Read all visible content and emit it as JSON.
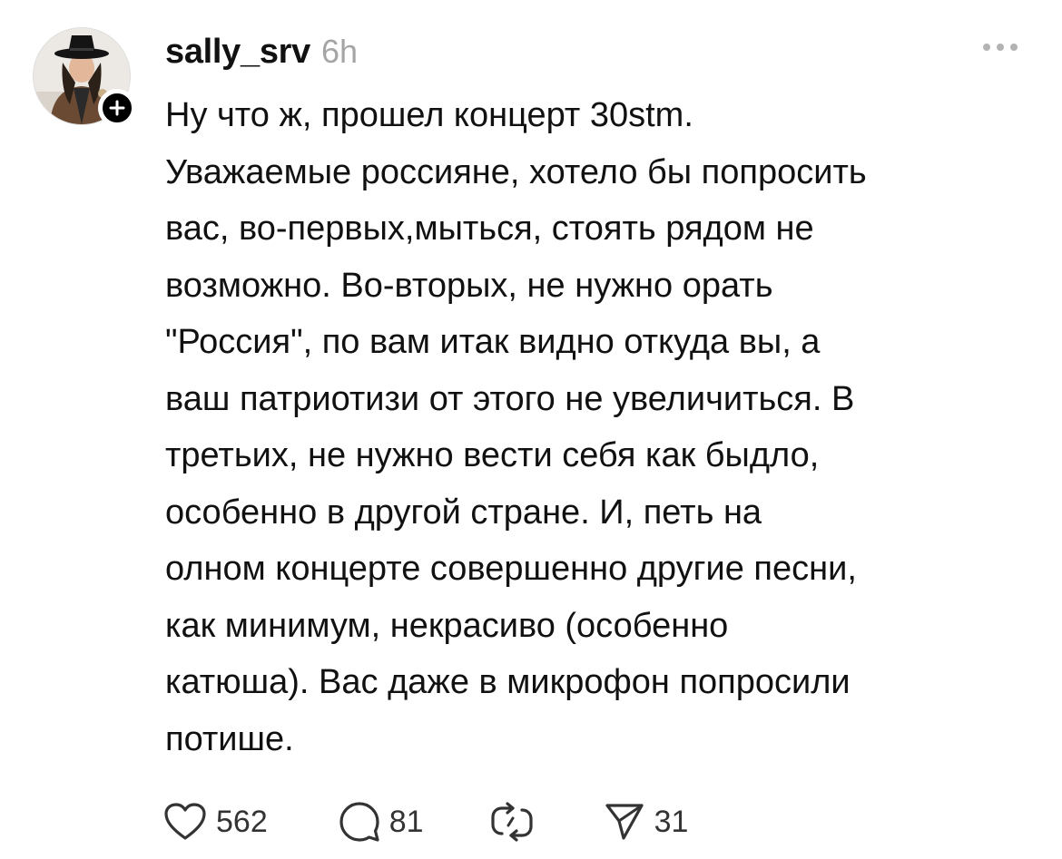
{
  "post": {
    "username": "sally_srv",
    "time": "6h",
    "body": "Ну что ж, прошел концерт 30stm.\nУважаемые россияне, хотело бы попросить\nвас, во-первых,мыться, стоять рядом не\nвозможно. Во-вторых, не нужно орать\n\"Россия\", по вам итак видно откуда вы, а\nваш патриотизи от этого не увеличиться. В\nтретьих, не нужно вести себя как быдло,\nособенно в другой стране. И, петь на\nолном концерте совершенно другие песни,\nкак минимум, некрасиво (особенно\nкатюша). Вас даже в микрофон попросили\nпотише."
  },
  "actions": {
    "likes": "562",
    "comments": "81",
    "shares": "31"
  },
  "icons": {
    "like": "heart-icon",
    "comment": "comment-bubble-icon",
    "repost": "repost-icon",
    "share": "send-icon",
    "follow": "plus-icon",
    "more": "more-dots-icon"
  },
  "colors": {
    "text": "#111111",
    "muted": "#a5a5a5",
    "icon": "#333333",
    "badge": "#000000"
  }
}
